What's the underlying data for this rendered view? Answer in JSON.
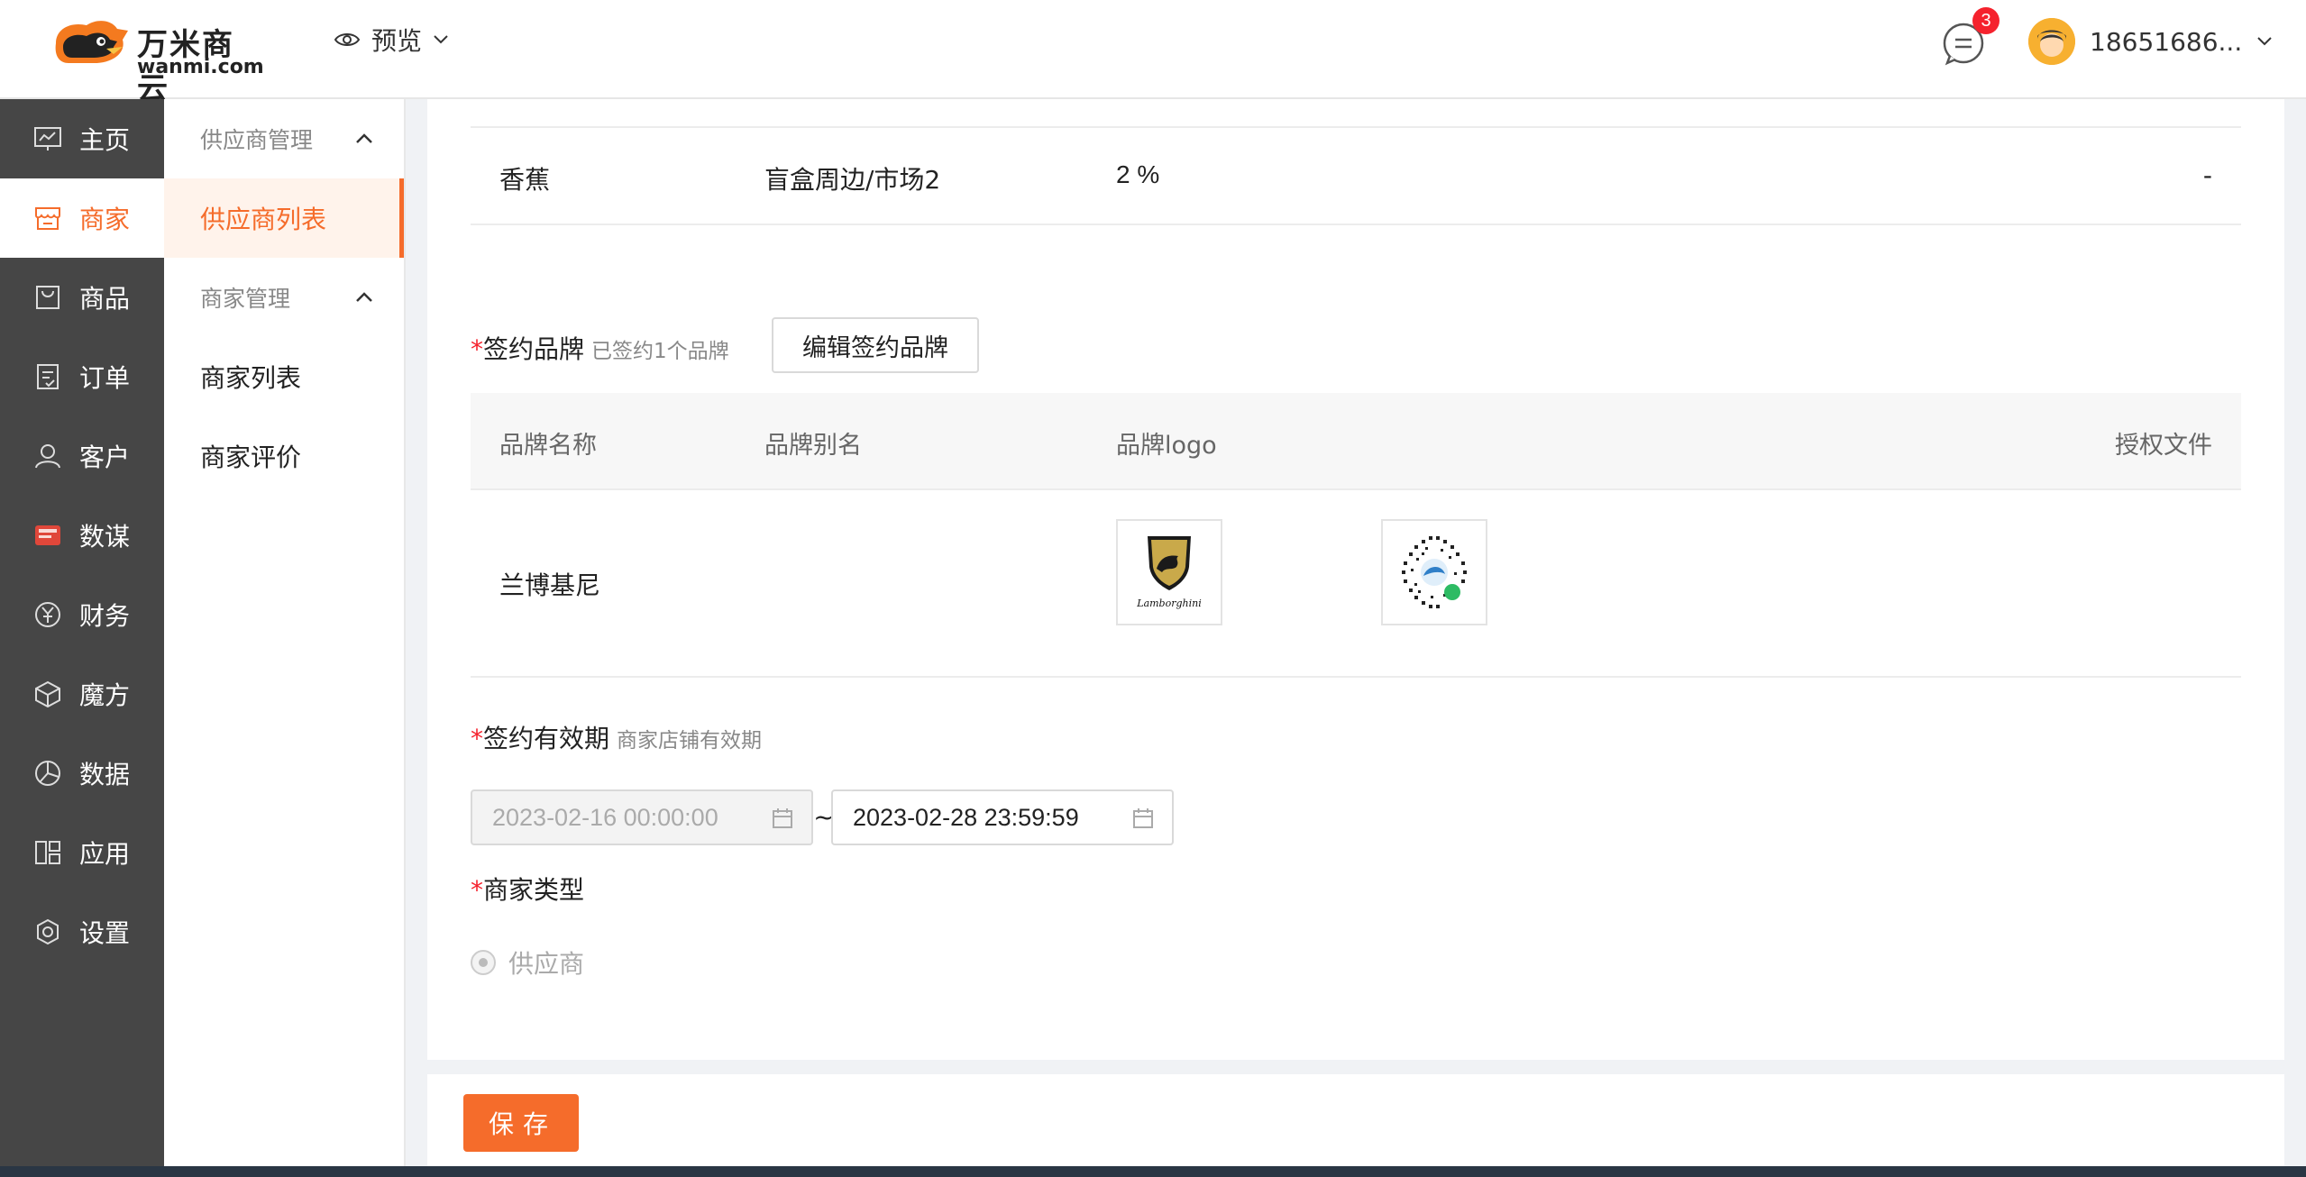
{
  "header": {
    "logo_title": "万米商云",
    "logo_sub": "wanmi.com",
    "preview_label": "预览",
    "message_count": "3",
    "user_name": "18651686..."
  },
  "nav": {
    "items": [
      {
        "label": "主页",
        "icon": "dashboard-icon"
      },
      {
        "label": "商家",
        "icon": "shop-icon"
      },
      {
        "label": "商品",
        "icon": "bag-icon"
      },
      {
        "label": "订单",
        "icon": "order-icon"
      },
      {
        "label": "客户",
        "icon": "user-icon"
      },
      {
        "label": "数谋",
        "icon": "badge-icon"
      },
      {
        "label": "财务",
        "icon": "yen-icon"
      },
      {
        "label": "魔方",
        "icon": "cube-icon"
      },
      {
        "label": "数据",
        "icon": "pie-chart-icon"
      },
      {
        "label": "应用",
        "icon": "apps-icon"
      },
      {
        "label": "设置",
        "icon": "gear-icon"
      }
    ]
  },
  "submenu": {
    "group1": "供应商管理",
    "item1": "供应商列表",
    "group2": "商家管理",
    "item2": "商家列表",
    "item3": "商家评价"
  },
  "category_row": {
    "name": "香蕉",
    "path": "盲盒周边/市场2",
    "rate": "2 %",
    "extra": "-"
  },
  "brand": {
    "label": "签约品牌",
    "hint": "已签约1个品牌",
    "edit_button": "编辑签约品牌",
    "columns": [
      "品牌名称",
      "品牌别名",
      "品牌logo",
      "授权文件"
    ],
    "rows": [
      {
        "name": "兰博基尼",
        "alias": "",
        "logo_text": "Lamborghini"
      }
    ]
  },
  "validity": {
    "label": "签约有效期",
    "hint": "商家店铺有效期",
    "start": "2023-02-16 00:00:00",
    "separator": "~",
    "end": "2023-02-28 23:59:59"
  },
  "merchant_type": {
    "label": "商家类型",
    "option": "供应商"
  },
  "footer": {
    "save_label": "保存"
  },
  "colors": {
    "accent": "#f56c2b",
    "nav_bg": "#464646",
    "required": "#f5222d"
  }
}
